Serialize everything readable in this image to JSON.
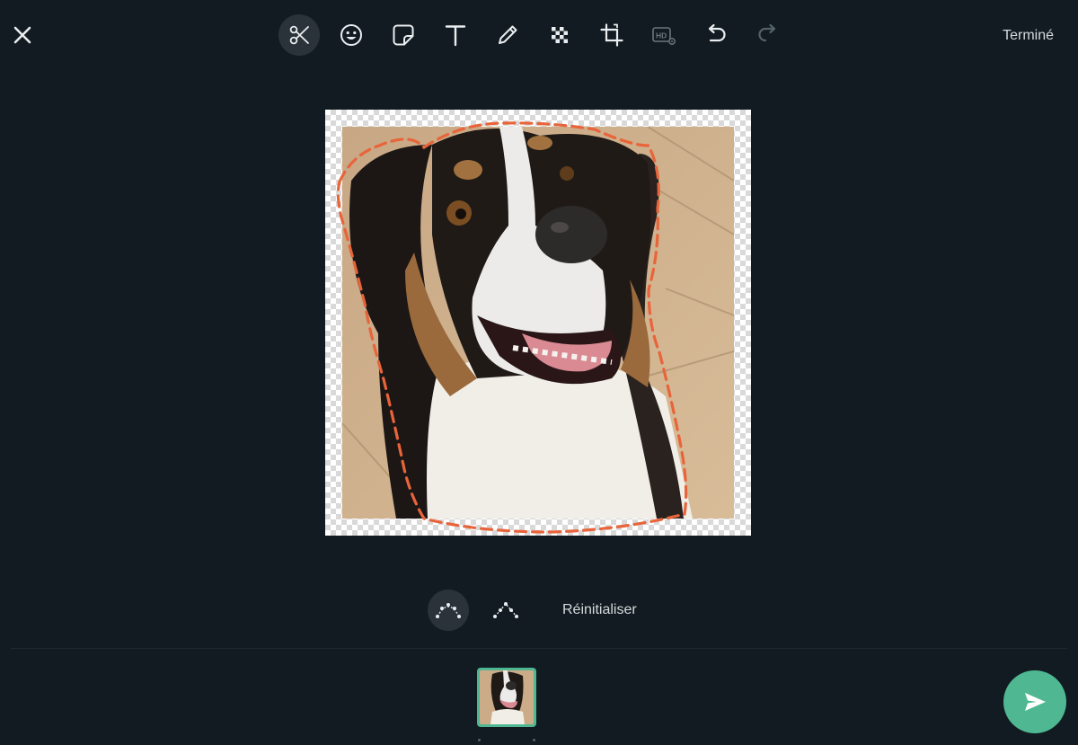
{
  "toolbar": {
    "close_icon": "close-icon",
    "tools": [
      {
        "name": "scissors-icon",
        "active": true
      },
      {
        "name": "emoji-icon",
        "active": false
      },
      {
        "name": "sticker-icon",
        "active": false
      },
      {
        "name": "text-icon",
        "active": false
      },
      {
        "name": "pencil-icon",
        "active": false
      },
      {
        "name": "blur-mosaic-icon",
        "active": false
      },
      {
        "name": "crop-icon",
        "active": false
      },
      {
        "name": "hd-settings-icon",
        "active": false
      },
      {
        "name": "undo-icon",
        "active": false
      },
      {
        "name": "redo-icon",
        "active": false
      }
    ],
    "done_label": "Terminé"
  },
  "editor": {
    "image_subject": "dog photo with cutout selection",
    "outline_color": "#e8643a"
  },
  "cut_controls": {
    "freeform_mode_icon": "curve-points-icon",
    "polygon_mode_icon": "polygon-points-icon",
    "reset_label": "Réinitialiser"
  },
  "footer": {
    "send_icon": "send-icon"
  },
  "colors": {
    "background": "#111b21",
    "accent": "#4fb791",
    "outline": "#e8643a"
  }
}
